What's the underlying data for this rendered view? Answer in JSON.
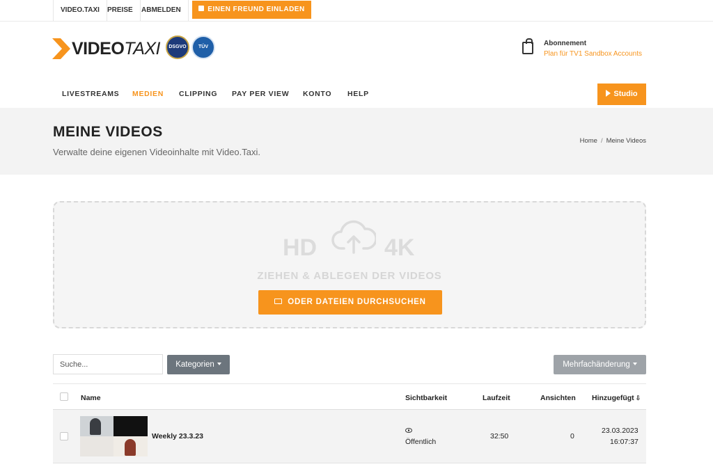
{
  "topbar": {
    "links": [
      "VIDEO.TAXI",
      "PREISE",
      "ABMELDEN"
    ],
    "invite_label": "EINEN FREUND EINLADEN"
  },
  "header": {
    "logo_bold": "VIDEO",
    "logo_thin": "TAXI",
    "seal1_text": "DSGVO",
    "seal2_text": "TÜV",
    "abo_title": "Abonnement",
    "abo_plan": "Plan für TV1 Sandbox Accounts"
  },
  "nav": {
    "items": [
      "LIVESTREAMS",
      "MEDIEN",
      "CLIPPING",
      "PAY PER VIEW",
      "KONTO",
      "HELP"
    ],
    "active_index": 1,
    "studio_label": "Studio"
  },
  "page": {
    "title": "MEINE VIDEOS",
    "subtitle": "Verwalte deine eigenen Videoinhalte mit Video.Taxi.",
    "breadcrumb": [
      "Home",
      "Meine Videos"
    ]
  },
  "upload": {
    "hd_label": "HD",
    "k4_label": "4K",
    "drag_text": "ZIEHEN & ABLEGEN DER VIDEOS",
    "browse_label": "ODER DATEIEN DURCHSUCHEN"
  },
  "controls": {
    "search_placeholder": "Suche...",
    "categories_label": "Kategorien",
    "multi_label": "Mehrfachänderung"
  },
  "table": {
    "columns": [
      "Name",
      "Sichtbarkeit",
      "Laufzeit",
      "Ansichten",
      "Hinzugefügt"
    ],
    "rows": [
      {
        "name": "Weekly 23.3.23",
        "visibility": "Öffentlich",
        "duration": "32:50",
        "views": "0",
        "added_date": "23.03.2023",
        "added_time": "16:07:37"
      }
    ]
  },
  "colors": {
    "accent": "#f7941d",
    "band_bg": "#f3f3f3",
    "secondary_btn": "#6c757d"
  }
}
